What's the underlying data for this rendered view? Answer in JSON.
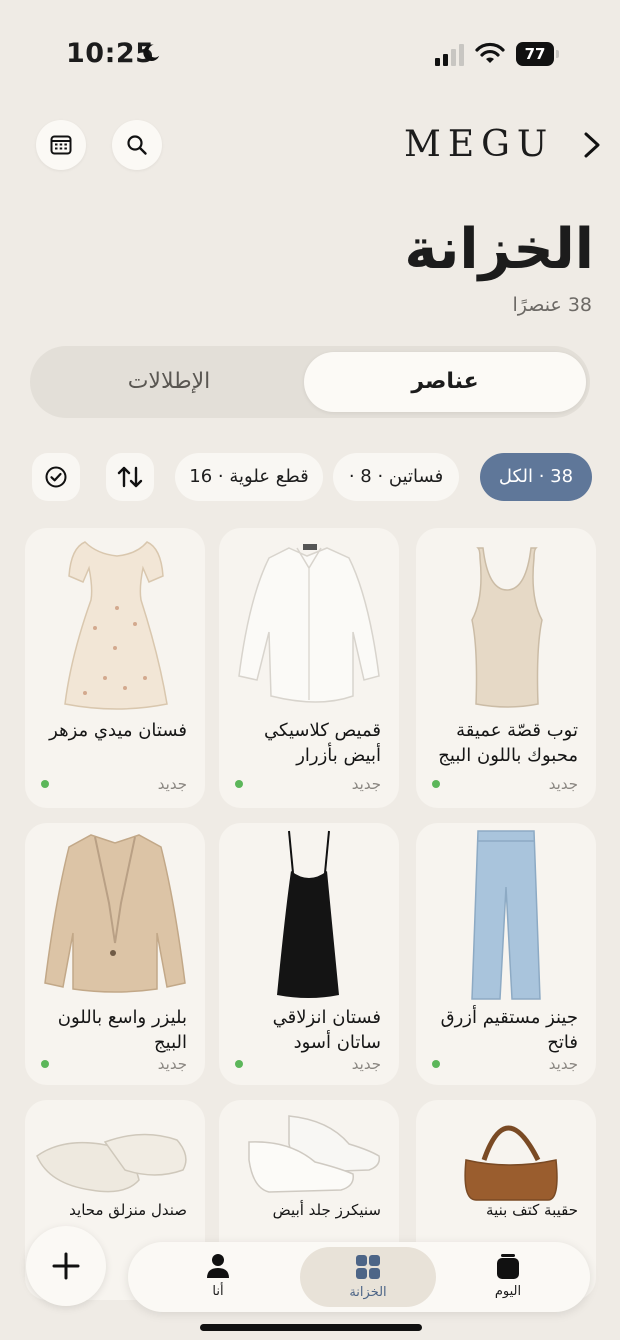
{
  "status_bar": {
    "time": "10:25",
    "battery": "77"
  },
  "header": {
    "brand": "MEGU",
    "title": "الخزانة",
    "subtitle": "38 عنصرًا"
  },
  "tabs": [
    {
      "label": "عناصر",
      "active": true
    },
    {
      "label": "الإطلالات",
      "active": false
    }
  ],
  "filters": [
    {
      "label": "38 · الكل",
      "active": true
    },
    {
      "label": "فساتين · 8 ·",
      "active": false
    },
    {
      "label": "قطع علوية · 16",
      "active": false
    }
  ],
  "items": [
    {
      "name": "توب قصّة عميقة محبوك باللون البيج",
      "tag": "جديد"
    },
    {
      "name": "قميص كلاسيكي أبيض بأزرار",
      "tag": "جديد"
    },
    {
      "name": "فستان ميدي مزهر",
      "tag": "جديد"
    },
    {
      "name": "جينز مستقيم أزرق فاتح",
      "tag": "جديد"
    },
    {
      "name": "فستان انزلاقي ساتان أسود",
      "tag": "جديد"
    },
    {
      "name": "بليزر واسع باللون البيج",
      "tag": "جديد"
    },
    {
      "name": "حقيبة كتف بنية",
      "tag": ""
    },
    {
      "name": "سنيكرز جلد أبيض",
      "tag": ""
    },
    {
      "name": "صندل منزلق محايد",
      "tag": ""
    }
  ],
  "bottom_nav": {
    "today": "اليوم",
    "wardrobe": "الخزانة",
    "me": "أنا"
  },
  "colors": {
    "background": "#efebe5",
    "accent": "#5f7799",
    "new_dot": "#5cb65a"
  }
}
